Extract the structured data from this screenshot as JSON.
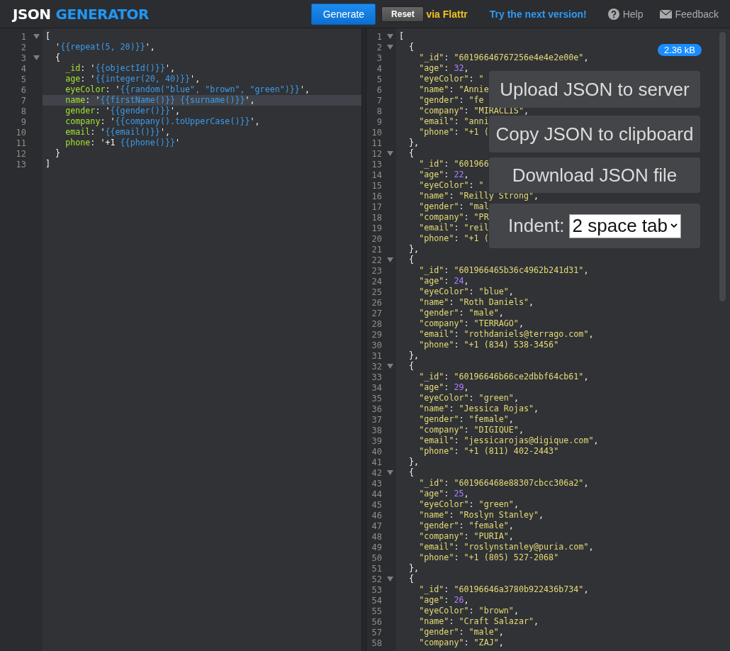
{
  "header": {
    "logo_first": "JSON",
    "logo_second": "GENERATOR",
    "generate_button": "Generate",
    "reset_button": "Reset",
    "flattr_link": "via Flattr",
    "next_version_link": "Try the next version!",
    "help_link": "Help",
    "feedback_link": "Feedback"
  },
  "template_editor": {
    "lines": [
      {
        "number": "1",
        "text": "[",
        "fold": true,
        "active": false
      },
      {
        "number": "2",
        "text": "  '{{repeat(5, 20)}}',",
        "fold": false,
        "active": false
      },
      {
        "number": "3",
        "text": "  {",
        "fold": true,
        "active": false
      },
      {
        "number": "4",
        "text": "    _id: '{{objectId()}}',",
        "fold": false,
        "active": false
      },
      {
        "number": "5",
        "text": "    age: '{{integer(20, 40)}}',",
        "fold": false,
        "active": false
      },
      {
        "number": "6",
        "text": "    eyeColor: '{{random(\"blue\", \"brown\", \"green\")}}',",
        "fold": false,
        "active": false
      },
      {
        "number": "7",
        "text": "    name: '{{firstName()}} {{surname()}}',",
        "fold": false,
        "active": true
      },
      {
        "number": "8",
        "text": "    gender: '{{gender()}}',",
        "fold": false,
        "active": false
      },
      {
        "number": "9",
        "text": "    company: '{{company().toUpperCase()}}',",
        "fold": false,
        "active": false
      },
      {
        "number": "10",
        "text": "    email: '{{email()}}',",
        "fold": false,
        "active": false
      },
      {
        "number": "11",
        "text": "    phone: '+1 {{phone()}}'",
        "fold": false,
        "active": false
      },
      {
        "number": "12",
        "text": "  }",
        "fold": false,
        "active": false
      },
      {
        "number": "13",
        "text": "]",
        "fold": false,
        "active": false
      }
    ]
  },
  "output_editor": {
    "size_badge": "2.36 kB",
    "actions": [
      {
        "label": "Upload JSON to server"
      },
      {
        "label": "Copy JSON to clipboard"
      },
      {
        "label": "Download JSON file"
      }
    ],
    "indent": {
      "label": "Indent:",
      "value": "2 space tab"
    },
    "lines": [
      {
        "number": "1",
        "text": "[",
        "fold": true
      },
      {
        "number": "2",
        "text": "  {",
        "fold": true
      },
      {
        "number": "3",
        "text": "    \"_id\": \"60196646767256e4e4e2e00e\",",
        "fold": false
      },
      {
        "number": "4",
        "text": "    \"age\": 32,",
        "fold": false
      },
      {
        "number": "5",
        "text": "    \"eyeColor\": \"",
        "fold": false
      },
      {
        "number": "6",
        "text": "    \"name\": \"Annie",
        "fold": false
      },
      {
        "number": "7",
        "text": "    \"gender\": \"fe",
        "fold": false
      },
      {
        "number": "8",
        "text": "    \"company\": \"MIRACLIS\",",
        "fold": false
      },
      {
        "number": "9",
        "text": "    \"email\": \"anni",
        "fold": false
      },
      {
        "number": "10",
        "text": "    \"phone\": \"+1 (",
        "fold": false
      },
      {
        "number": "11",
        "text": "  },",
        "fold": false
      },
      {
        "number": "12",
        "text": "  {",
        "fold": true
      },
      {
        "number": "13",
        "text": "    \"_id\": \"601966",
        "fold": false
      },
      {
        "number": "14",
        "text": "    \"age\": 22,",
        "fold": false
      },
      {
        "number": "15",
        "text": "    \"eyeColor\": \"",
        "fold": false
      },
      {
        "number": "16",
        "text": "    \"name\": \"Reilly Strong\",",
        "fold": false
      },
      {
        "number": "17",
        "text": "    \"gender\": \"mal",
        "fold": false
      },
      {
        "number": "18",
        "text": "    \"company\": \"PR",
        "fold": false
      },
      {
        "number": "19",
        "text": "    \"email\": \"reil",
        "fold": false
      },
      {
        "number": "20",
        "text": "    \"phone\": \"+1 (",
        "fold": false
      },
      {
        "number": "21",
        "text": "  },",
        "fold": false
      },
      {
        "number": "22",
        "text": "  {",
        "fold": true
      },
      {
        "number": "23",
        "text": "    \"_id\": \"601966465b36c4962b241d31\",",
        "fold": false
      },
      {
        "number": "24",
        "text": "    \"age\": 24,",
        "fold": false
      },
      {
        "number": "25",
        "text": "    \"eyeColor\": \"blue\",",
        "fold": false
      },
      {
        "number": "26",
        "text": "    \"name\": \"Roth Daniels\",",
        "fold": false
      },
      {
        "number": "27",
        "text": "    \"gender\": \"male\",",
        "fold": false
      },
      {
        "number": "28",
        "text": "    \"company\": \"TERRAGO\",",
        "fold": false
      },
      {
        "number": "29",
        "text": "    \"email\": \"rothdaniels@terrago.com\",",
        "fold": false
      },
      {
        "number": "30",
        "text": "    \"phone\": \"+1 (834) 538-3456\"",
        "fold": false
      },
      {
        "number": "31",
        "text": "  },",
        "fold": false
      },
      {
        "number": "32",
        "text": "  {",
        "fold": true
      },
      {
        "number": "33",
        "text": "    \"_id\": \"60196646b66ce2dbbf64cb61\",",
        "fold": false
      },
      {
        "number": "34",
        "text": "    \"age\": 29,",
        "fold": false
      },
      {
        "number": "35",
        "text": "    \"eyeColor\": \"green\",",
        "fold": false
      },
      {
        "number": "36",
        "text": "    \"name\": \"Jessica Rojas\",",
        "fold": false
      },
      {
        "number": "37",
        "text": "    \"gender\": \"female\",",
        "fold": false
      },
      {
        "number": "38",
        "text": "    \"company\": \"DIGIQUE\",",
        "fold": false
      },
      {
        "number": "39",
        "text": "    \"email\": \"jessicarojas@digique.com\",",
        "fold": false
      },
      {
        "number": "40",
        "text": "    \"phone\": \"+1 (811) 402-2443\"",
        "fold": false
      },
      {
        "number": "41",
        "text": "  },",
        "fold": false
      },
      {
        "number": "42",
        "text": "  {",
        "fold": true
      },
      {
        "number": "43",
        "text": "    \"_id\": \"601966468e88307cbcc306a2\",",
        "fold": false
      },
      {
        "number": "44",
        "text": "    \"age\": 25,",
        "fold": false
      },
      {
        "number": "45",
        "text": "    \"eyeColor\": \"green\",",
        "fold": false
      },
      {
        "number": "46",
        "text": "    \"name\": \"Roslyn Stanley\",",
        "fold": false
      },
      {
        "number": "47",
        "text": "    \"gender\": \"female\",",
        "fold": false
      },
      {
        "number": "48",
        "text": "    \"company\": \"PURIA\",",
        "fold": false
      },
      {
        "number": "49",
        "text": "    \"email\": \"roslynstanley@puria.com\",",
        "fold": false
      },
      {
        "number": "50",
        "text": "    \"phone\": \"+1 (805) 527-2068\"",
        "fold": false
      },
      {
        "number": "51",
        "text": "  },",
        "fold": false
      },
      {
        "number": "52",
        "text": "  {",
        "fold": true
      },
      {
        "number": "53",
        "text": "    \"_id\": \"60196646a3780b922436b734\",",
        "fold": false
      },
      {
        "number": "54",
        "text": "    \"age\": 26,",
        "fold": false
      },
      {
        "number": "55",
        "text": "    \"eyeColor\": \"brown\",",
        "fold": false
      },
      {
        "number": "56",
        "text": "    \"name\": \"Craft Salazar\",",
        "fold": false
      },
      {
        "number": "57",
        "text": "    \"gender\": \"male\",",
        "fold": false
      },
      {
        "number": "58",
        "text": "    \"company\": \"ZAJ\",",
        "fold": false
      }
    ]
  }
}
